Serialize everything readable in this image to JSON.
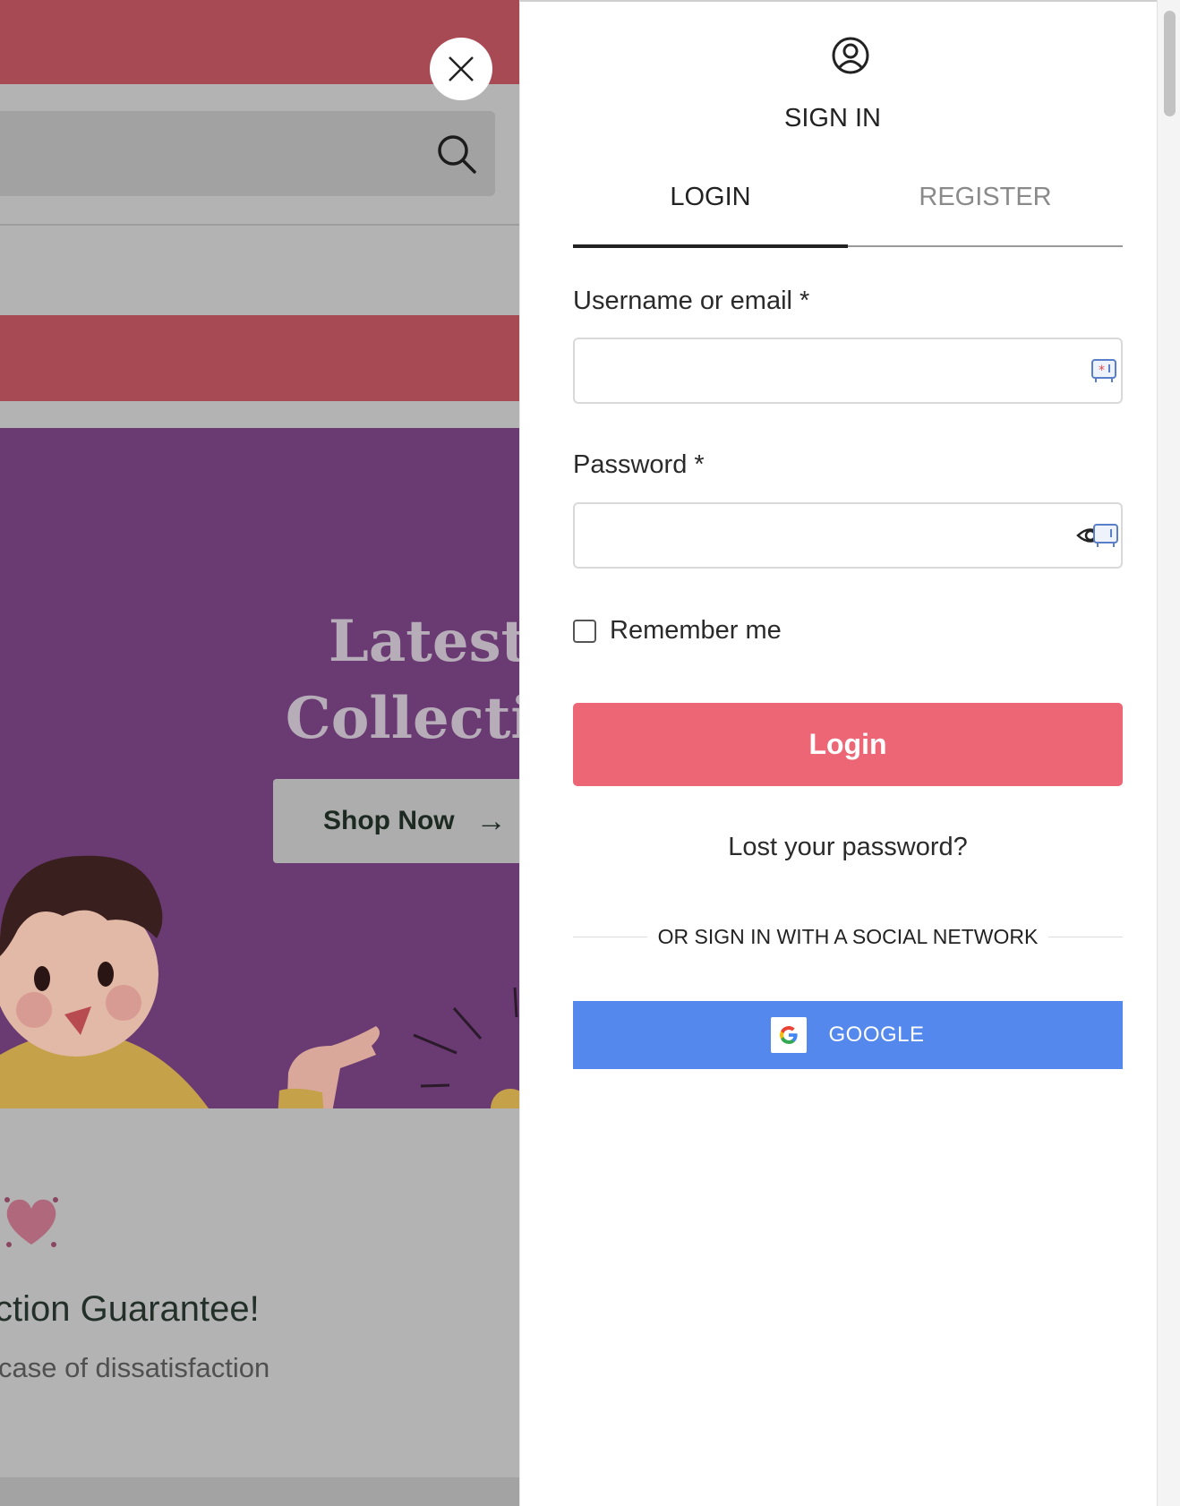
{
  "background": {
    "hero": {
      "title_lines": "Latest\nCollectio",
      "cta_label": "Shop Now",
      "cta_arrow": "→"
    },
    "guarantee_title": "ction Guarantee!",
    "guarantee_sub": "case of dissatisfaction",
    "colors": {
      "topbar": "#a84a54",
      "hero": "#6a3a73"
    }
  },
  "panel": {
    "title": "SIGN IN",
    "tabs": [
      {
        "label": "LOGIN",
        "active": true
      },
      {
        "label": "REGISTER",
        "active": false
      }
    ],
    "form": {
      "username_label": "Username or email *",
      "username_value": "",
      "password_label": "Password *",
      "password_value": "",
      "remember_label": "Remember me",
      "remember_checked": false,
      "submit_label": "Login",
      "lost_password_label": "Lost your password?"
    },
    "social": {
      "divider_text": "OR SIGN IN WITH A SOCIAL NETWORK",
      "google_label": "GOOGLE"
    },
    "colors": {
      "login_button": "#ec6676",
      "google_button": "#5488ec"
    },
    "icons": {
      "close": "close-icon",
      "user": "user-circle-icon",
      "password_manager": "password-manager-icon",
      "reveal": "eye-icon",
      "google": "google-logo-icon"
    }
  }
}
